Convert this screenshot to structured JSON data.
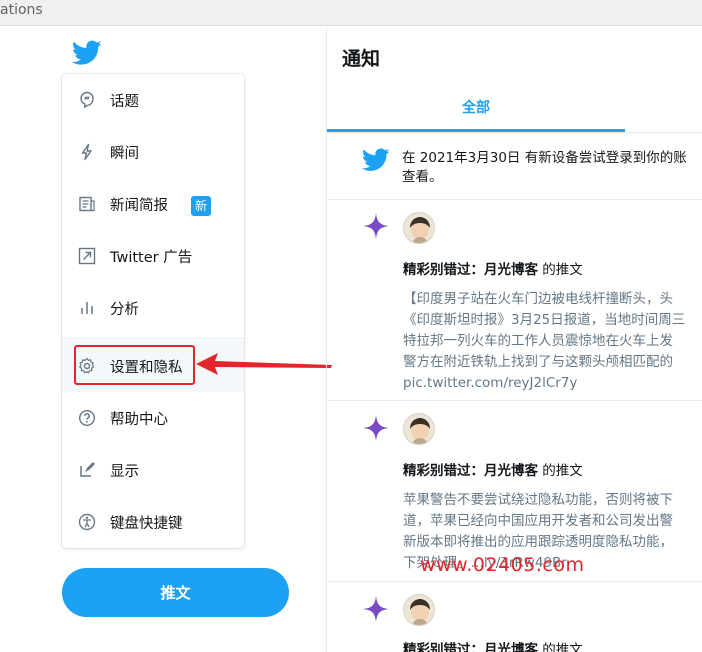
{
  "browser": {
    "url_fragment": "ations"
  },
  "sidebar": {
    "items": [
      {
        "label": "话题",
        "icon": "topic-icon"
      },
      {
        "label": "瞬间",
        "icon": "lightning-icon"
      },
      {
        "label": "新闻简报",
        "icon": "newsletter-icon",
        "badge": "新"
      },
      {
        "label": "Twitter 广告",
        "icon": "external-link-icon"
      },
      {
        "label": "分析",
        "icon": "analytics-icon"
      },
      {
        "label": "设置和隐私",
        "icon": "gear-icon"
      },
      {
        "label": "帮助中心",
        "icon": "help-icon"
      },
      {
        "label": "显示",
        "icon": "display-icon"
      },
      {
        "label": "键盘快捷键",
        "icon": "accessibility-icon"
      }
    ],
    "tweet_button": "推文"
  },
  "main": {
    "title": "通知",
    "tabs": [
      {
        "label": "全部",
        "active": true
      }
    ],
    "notifications": [
      {
        "type": "login",
        "text_lines": [
          "在 2021年3月30日 有新设备尝试登录到你的账",
          "查看。"
        ]
      },
      {
        "type": "recommended",
        "headline_prefix": "精彩别错过：",
        "headline_user": "月光博客",
        "headline_suffix": " 的推文",
        "body_lines": [
          "【印度男子站在火车门边被电线杆撞断头，头",
          "《印度斯坦时报》3月25日报道，当地时间周三",
          "特拉邦一列火车的工作人员震惊地在火车上发",
          "警方在附近铁轨上找到了与这颗头颅相匹配的",
          "pic.twitter.com/reyJ2lCr7y"
        ]
      },
      {
        "type": "recommended",
        "headline_prefix": "精彩别错过：",
        "headline_user": "月光博客",
        "headline_suffix": " 的推文",
        "body_lines": [
          "苹果警告不要尝试绕过隐私功能，否则将被下",
          "道，苹果已经向中国应用开发者和公司发出警",
          "新版本即将推出的应用跟踪透明度隐私功能，",
          "下架处理。…ly/3rRw49Br"
        ]
      },
      {
        "type": "recommended",
        "headline_prefix": "精彩别错过：",
        "headline_user": "月光博客",
        "headline_suffix": " 的推文"
      }
    ]
  },
  "watermark": "www.02405.com",
  "colors": {
    "brand": "#1da1f2",
    "annotation": "#e2262b",
    "sparkle": "#794bc4"
  }
}
